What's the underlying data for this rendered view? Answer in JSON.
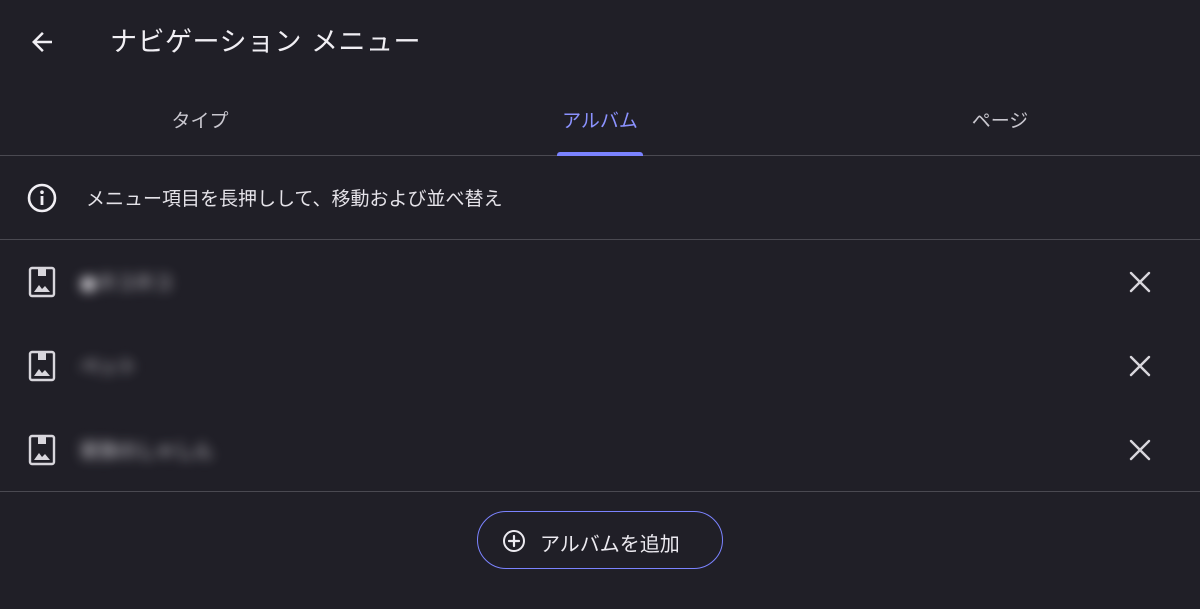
{
  "header": {
    "title": "ナビゲーション メニュー",
    "back_icon": "arrow-back-icon"
  },
  "tabs": [
    {
      "label": "タイプ",
      "active": false
    },
    {
      "label": "アルバム",
      "active": true
    },
    {
      "label": "ページ",
      "active": false
    }
  ],
  "info": {
    "icon": "info-icon",
    "text": "メニュー項目を長押しして、移動および並べ替え"
  },
  "albums": [
    {
      "name": "●ネコネコ",
      "icon": "album-icon",
      "remove_icon": "close-icon"
    },
    {
      "name": "ペット",
      "icon": "album-icon",
      "remove_icon": "close-icon"
    },
    {
      "name": "家族のしゃしん",
      "icon": "album-icon",
      "remove_icon": "close-icon"
    }
  ],
  "add_button": {
    "label": "アルバムを追加",
    "icon": "add-circle-icon"
  },
  "colors": {
    "background": "#201f27",
    "accent": "#7b83ff",
    "divider": "#4a4951"
  }
}
